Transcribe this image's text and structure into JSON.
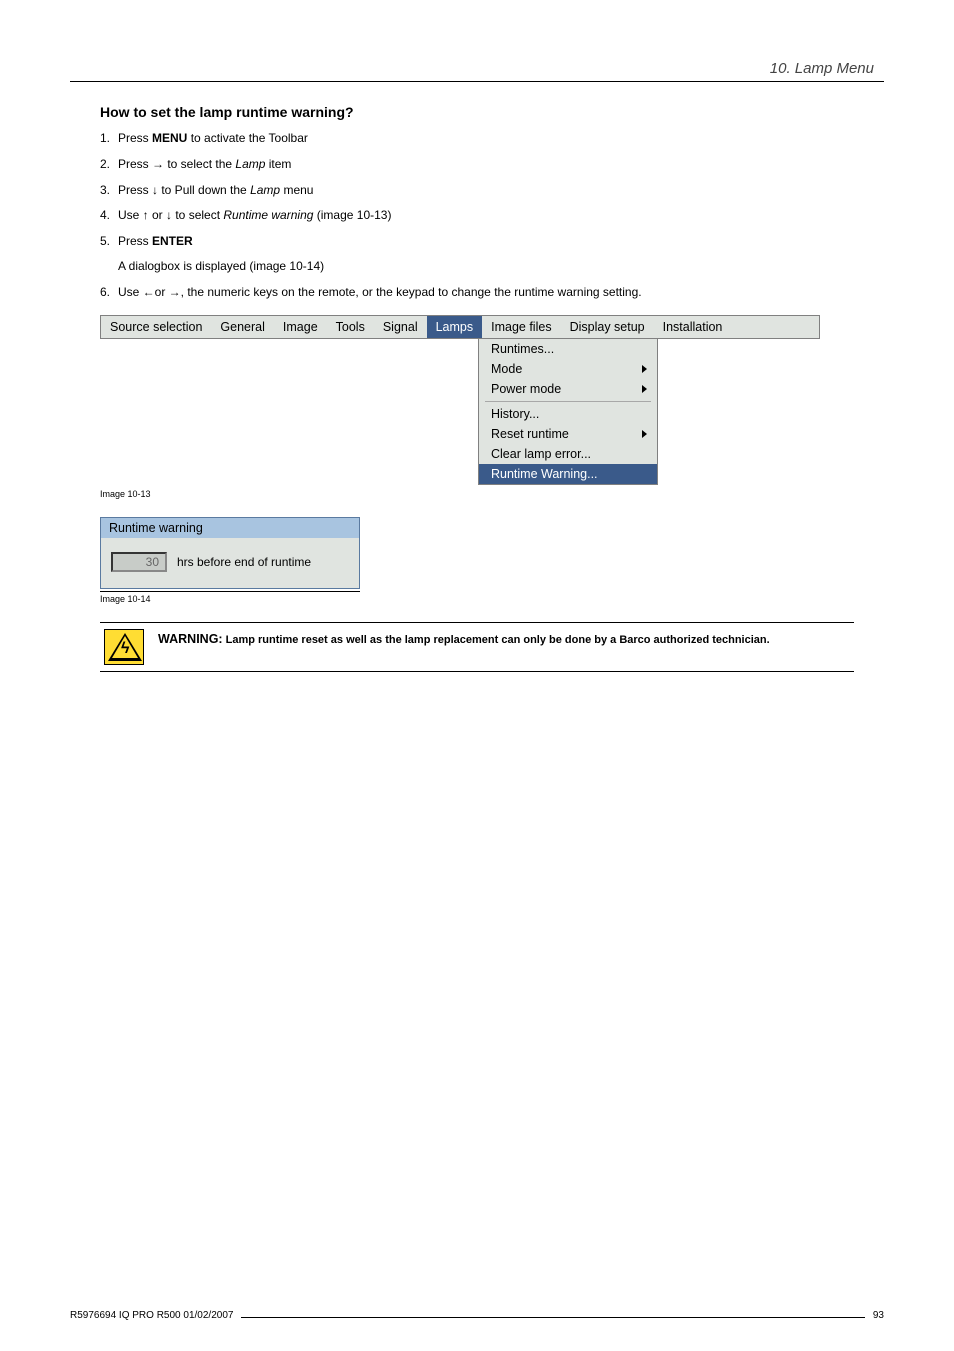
{
  "header": {
    "chapter": "10. Lamp Menu"
  },
  "section": {
    "title": "How to set the lamp runtime warning?"
  },
  "steps": [
    {
      "num": "1.",
      "pre": "Press ",
      "bold": "MENU",
      "post": " to activate the Toolbar"
    },
    {
      "num": "2.",
      "pre": "Press → to select the ",
      "italic": "Lamp",
      "post": " item"
    },
    {
      "num": "3.",
      "pre": "Press ↓ to Pull down the ",
      "italic": "Lamp",
      "post": " menu"
    },
    {
      "num": "4.",
      "pre": "Use ↑ or ↓ to select ",
      "italic": "Runtime warning",
      "post": " (image 10-13)"
    },
    {
      "num": "5.",
      "pre": "Press ",
      "bold": "ENTER",
      "post": "",
      "sub": "A dialogbox is displayed (image 10-14)"
    },
    {
      "num": "6.",
      "pre": "Use ←or →, the numeric keys on the remote, or the keypad to change the runtime warning setting.",
      "bold": "",
      "post": ""
    }
  ],
  "menubar": {
    "tabs": [
      "Source selection",
      "General",
      "Image",
      "Tools",
      "Signal",
      "Lamps",
      "Image files",
      "Display setup",
      "Installation"
    ],
    "active": "Lamps"
  },
  "dropdown": {
    "items": [
      {
        "label": "Runtimes...",
        "arrow": false
      },
      {
        "label": "Mode",
        "arrow": true
      },
      {
        "label": "Power mode",
        "arrow": true
      }
    ],
    "items2": [
      {
        "label": "History...",
        "arrow": false
      },
      {
        "label": "Reset runtime",
        "arrow": true
      },
      {
        "label": "Clear lamp error...",
        "arrow": false
      },
      {
        "label": "Runtime Warning...",
        "arrow": false,
        "active": true
      }
    ]
  },
  "captions": {
    "img1": "Image 10-13",
    "img2": "Image 10-14"
  },
  "dialog": {
    "title": "Runtime warning",
    "value": "30",
    "suffix": "hrs before end of runtime"
  },
  "warning": {
    "label": "WARNING:",
    "text": " Lamp runtime reset as well as the lamp replacement can only be done by a Barco authorized technician."
  },
  "footer": {
    "left": "R5976694  IQ PRO R500  01/02/2007",
    "right": "93"
  }
}
